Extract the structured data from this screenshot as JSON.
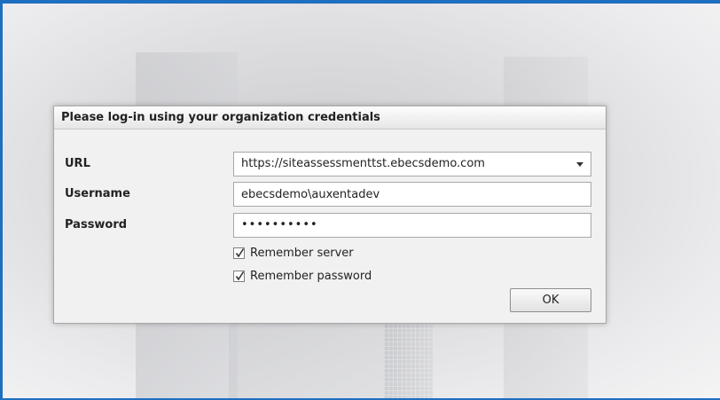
{
  "dialog": {
    "title": "Please log-in using your organization credentials",
    "url": {
      "label": "URL",
      "value": "https://siteassessmenttst.ebecsdemo.com"
    },
    "username": {
      "label": "Username",
      "value": "ebecsdemo\\auxentadev"
    },
    "password": {
      "label": "Password",
      "masked_value": "••••••••••"
    },
    "remember_server": {
      "label": "Remember server",
      "checked": true
    },
    "remember_password": {
      "label": "Remember password",
      "checked": true
    },
    "ok_label": "OK"
  },
  "colors": {
    "frame_border": "#1f6fc0",
    "dialog_bg": "#f1f1f1"
  }
}
